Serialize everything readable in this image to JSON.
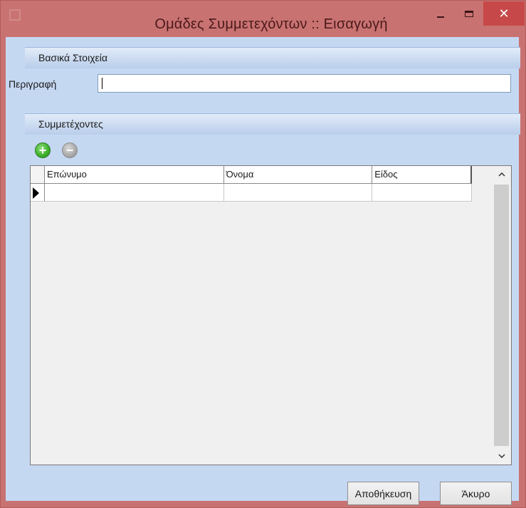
{
  "window": {
    "title": "Ομάδες Συμμετεχόντων :: Εισαγωγή",
    "close_glyph": "✕"
  },
  "basic_section": {
    "title": "Βασικά Στοιχεία",
    "description_label": "Περιγραφή",
    "description_value": ""
  },
  "members_section": {
    "title": "Συμμετέχοντες",
    "add_icon": "plus-circle-icon",
    "remove_icon": "minus-circle-icon",
    "grid": {
      "columns": [
        "Επώνυμο",
        "Όνομα",
        "Είδος"
      ],
      "rows": [
        [
          "",
          "",
          ""
        ]
      ]
    }
  },
  "footer": {
    "save_label": "Αποθήκευση",
    "cancel_label": "Άκυρο"
  },
  "colors": {
    "titlebar": "#c97272",
    "close_button": "#c74848",
    "client_background": "#c5d8f2"
  }
}
